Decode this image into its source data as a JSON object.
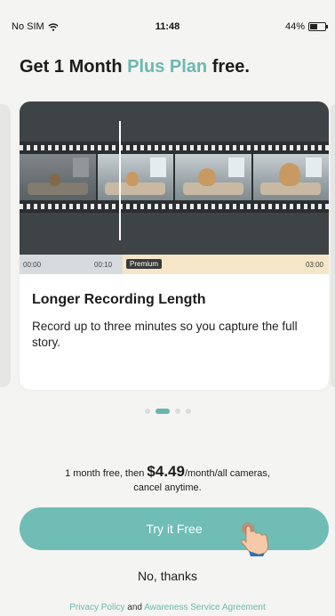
{
  "status_bar": {
    "carrier": "No SIM",
    "time": "11:48",
    "battery": "44%"
  },
  "headline": {
    "prefix": "Get 1 Month ",
    "accent": "Plus Plan",
    "suffix": " free."
  },
  "card": {
    "timeline": {
      "start": "00:00",
      "free_end": "00:10",
      "premium_label": "Premium",
      "end": "03:00"
    },
    "title": "Longer Recording Length",
    "description": "Record up to three minutes so you capture the full story."
  },
  "pager": {
    "count": 4,
    "active_index": 1
  },
  "pricing": {
    "prefix": "1 month free, then ",
    "price": "$4.49",
    "suffix": "/month/all cameras,",
    "line2": "cancel anytime."
  },
  "cta": {
    "label": "Try it Free"
  },
  "secondary": {
    "label": "No, thanks"
  },
  "legal": {
    "privacy": "Privacy Policy",
    "and": "and",
    "agreement": "Awareness Service Agreement"
  },
  "colors": {
    "accent": "#6ab9b0",
    "button": "#6fbdb4",
    "premium_band": "#f4e6c7",
    "background": "#f4f4f2"
  },
  "icons": {
    "wifi": "wifi-icon",
    "battery": "battery-icon",
    "hand": "tap-hand-icon"
  }
}
